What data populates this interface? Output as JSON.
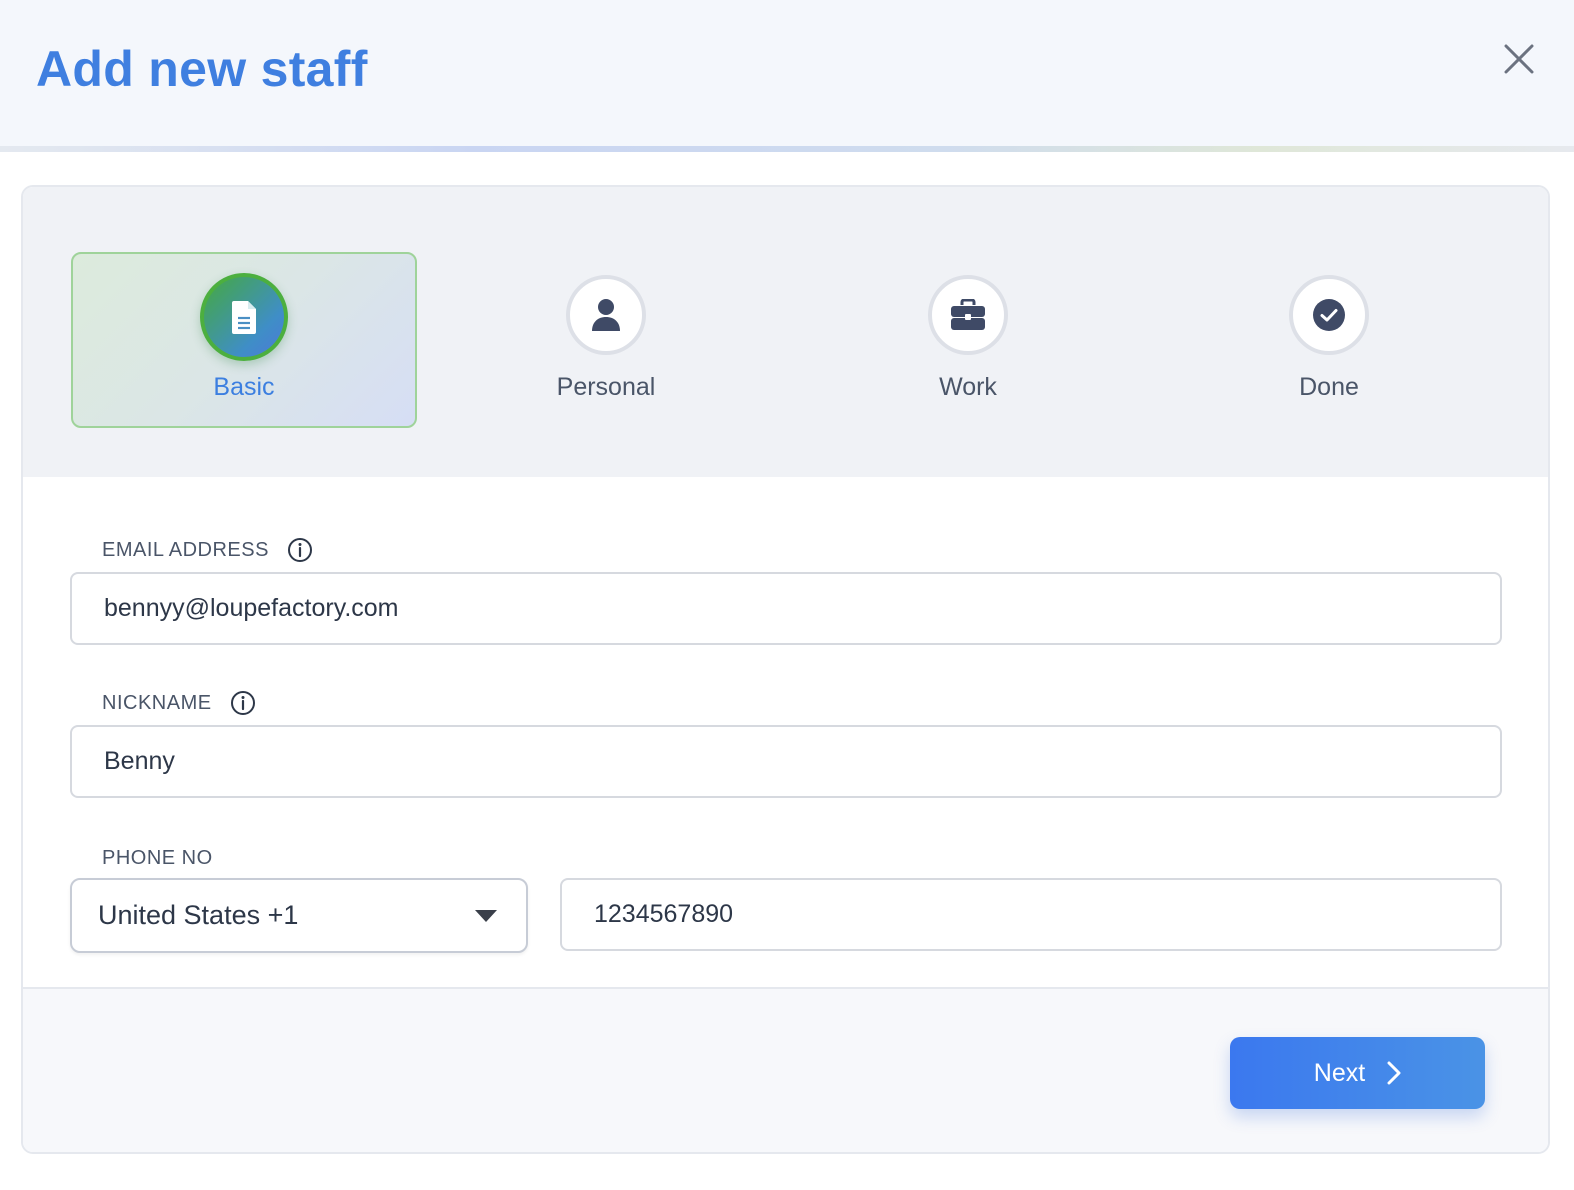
{
  "header": {
    "title": "Add new staff",
    "close_icon": "close-icon"
  },
  "steps": [
    {
      "label": "Basic",
      "icon": "document-icon",
      "active": true
    },
    {
      "label": "Personal",
      "icon": "user-icon",
      "active": false
    },
    {
      "label": "Work",
      "icon": "briefcase-icon",
      "active": false
    },
    {
      "label": "Done",
      "icon": "check-circle-icon",
      "active": false
    }
  ],
  "form": {
    "email": {
      "label": "EMAIL ADDRESS",
      "value": "bennyy@loupefactory.com",
      "info_icon": "info-icon"
    },
    "nickname": {
      "label": "NICKNAME",
      "value": "Benny",
      "info_icon": "info-icon"
    },
    "phone": {
      "label": "PHONE NO",
      "country_selected": "United States +1",
      "number": "1234567890"
    }
  },
  "footer": {
    "next_label": "Next",
    "next_icon": "chevron-right-icon"
  },
  "colors": {
    "accent": "#3f7fe0",
    "active_step_border": "#4caf3f",
    "button_start": "#3b78ef",
    "button_end": "#4a93e6"
  }
}
